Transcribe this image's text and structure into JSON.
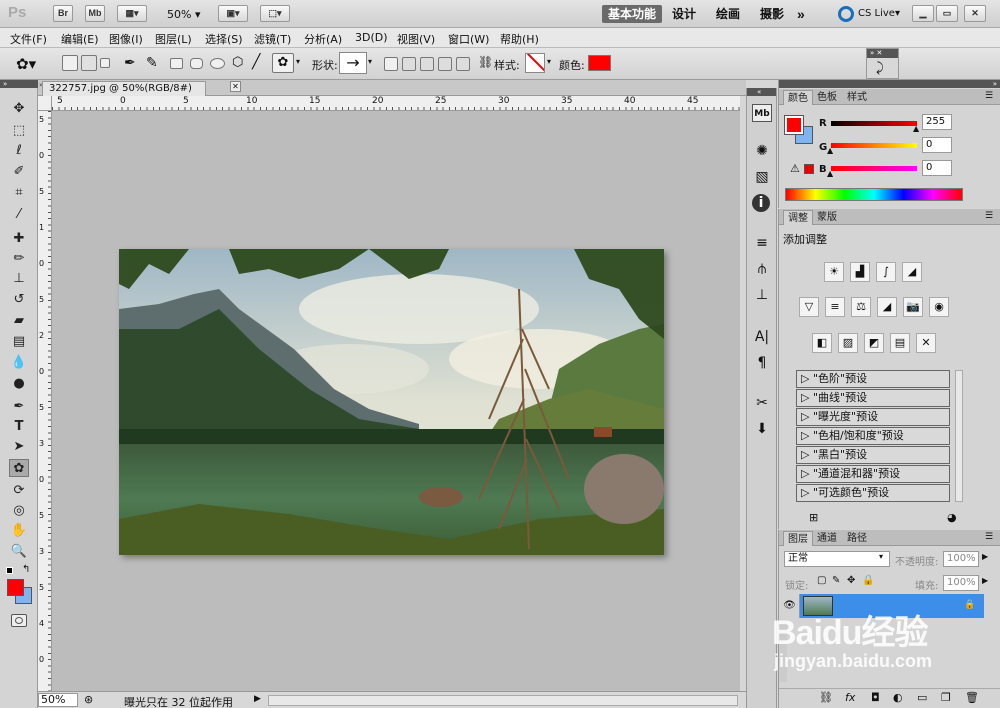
{
  "app": {
    "logo": "Ps",
    "bridge_btn": "Br",
    "minibridge_btn": "Mb",
    "zoom": "50%",
    "workspaces": [
      "基本功能",
      "设计",
      "绘画",
      "摄影"
    ],
    "more": "»",
    "cslive": "CS Live"
  },
  "menu": [
    "文件(F)",
    "编辑(E)",
    "图像(I)",
    "图层(L)",
    "选择(S)",
    "滤镜(T)",
    "分析(A)",
    "3D(D)",
    "视图(V)",
    "窗口(W)",
    "帮助(H)"
  ],
  "options": {
    "shape_label": "形状:",
    "shape_value": "→",
    "style_label": "样式:",
    "color_label": "颜色:",
    "color": "#ff0000"
  },
  "document": {
    "tab_title": "322757.jpg @ 50%(RGB/8#) *",
    "ruler_marks": [
      "5",
      "0",
      "5",
      "10",
      "15",
      "20",
      "25",
      "30",
      "35",
      "40",
      "45"
    ],
    "vruler_marks": [
      "5",
      "0",
      "5",
      "1",
      "0",
      "5",
      "2",
      "0",
      "5",
      "3",
      "0",
      "5",
      "3",
      "5",
      "4",
      "0"
    ]
  },
  "status": {
    "zoom": "50%",
    "message": "曝光只在 32 位起作用"
  },
  "color_panel": {
    "tabs": [
      "颜色",
      "色板",
      "样式"
    ],
    "r_label": "R",
    "g_label": "G",
    "b_label": "B",
    "r": "255",
    "g": "0",
    "b": "0",
    "fg": "#ff0000",
    "bg": "#7fb4f0"
  },
  "adjust_panel": {
    "tabs": [
      "调整",
      "蒙版"
    ],
    "title": "添加调整",
    "presets": [
      "\"色阶\"预设",
      "\"曲线\"预设",
      "\"曝光度\"预设",
      "\"色相/饱和度\"预设",
      "\"黑白\"预设",
      "\"通道混和器\"预设",
      "\"可选颜色\"预设"
    ]
  },
  "layers_panel": {
    "tabs": [
      "图层",
      "通道",
      "路径"
    ],
    "blend_mode": "正常",
    "opacity_label": "不透明度:",
    "opacity": "100%",
    "lock_label": "锁定:",
    "fill_label": "填充:",
    "fill": "100%"
  },
  "watermark": {
    "brand": "Baidu经验",
    "url": "jingyan.baidu.com"
  }
}
